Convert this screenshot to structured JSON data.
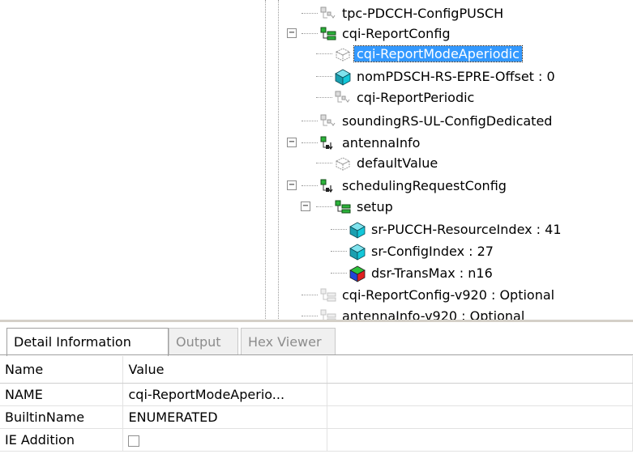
{
  "tree": {
    "nodes": [
      {
        "name": "tree-node-tpc-pdcch",
        "label": "tpc-PDCCH-ConfigPUSCH",
        "icon": "optional-sequence-icon"
      },
      {
        "name": "tree-node-cqi-reportconfig",
        "label": "cqi-ReportConfig",
        "icon": "sequence-icon",
        "expander": "⊟"
      },
      {
        "name": "tree-node-cqi-reportmodeaperiodic",
        "label": "cqi-ReportModeAperiodic",
        "icon": "enumerated-outline-icon",
        "selected": true
      },
      {
        "name": "tree-node-nompdsch",
        "label": "nomPDSCH-RS-EPRE-Offset : 0",
        "icon": "integer-cube-icon"
      },
      {
        "name": "tree-node-cqi-reportperiodic",
        "label": "cqi-ReportPeriodic",
        "icon": "optional-sequence-icon"
      },
      {
        "name": "tree-node-soundingrs",
        "label": "soundingRS-UL-ConfigDedicated",
        "icon": "optional-sequence-icon"
      },
      {
        "name": "tree-node-antennainfo",
        "label": "antennaInfo",
        "icon": "choice-icon",
        "expander": "⊟"
      },
      {
        "name": "tree-node-defaultvalue",
        "label": "defaultValue",
        "icon": "enumerated-outline-icon"
      },
      {
        "name": "tree-node-schedulingrequestconfig",
        "label": "schedulingRequestConfig",
        "icon": "choice-icon",
        "expander": "⊟"
      },
      {
        "name": "tree-node-setup",
        "label": "setup",
        "icon": "sequence-icon",
        "expander": "⊟"
      },
      {
        "name": "tree-node-sr-pucch",
        "label": "sr-PUCCH-ResourceIndex : 41",
        "icon": "integer-cube-icon"
      },
      {
        "name": "tree-node-sr-configindex",
        "label": "sr-ConfigIndex : 27",
        "icon": "integer-cube-icon"
      },
      {
        "name": "tree-node-dsr-transmax",
        "label": "dsr-TransMax : n16",
        "icon": "enumerated-cube-icon"
      },
      {
        "name": "tree-node-cqi-reportconfig-v920",
        "label": "cqi-ReportConfig-v920 : Optional",
        "icon": "optional-sequence-faded-icon"
      },
      {
        "name": "tree-node-antennainfo-v920",
        "label": "antennaInfo-v920 : Optional",
        "icon": "optional-sequence-faded-icon"
      }
    ]
  },
  "tabs": [
    {
      "name": "tab-detail-information",
      "label": "Detail Information",
      "active": true
    },
    {
      "name": "tab-output",
      "label": "Output",
      "active": false
    },
    {
      "name": "tab-hex-viewer",
      "label": "Hex Viewer",
      "active": false
    }
  ],
  "detail": {
    "columns": [
      "Name",
      "Value"
    ],
    "rows": [
      {
        "name": "NAME",
        "value": "cqi-ReportModeAperio..."
      },
      {
        "name": "BuiltinName",
        "value": "ENUMERATED"
      },
      {
        "name": "IE Addition",
        "value": "",
        "checkbox": false
      }
    ]
  },
  "colors": {
    "selection": "#3399ff",
    "cube_cyan": "#1fb7c9",
    "tree_line": "#9a9a9a"
  }
}
